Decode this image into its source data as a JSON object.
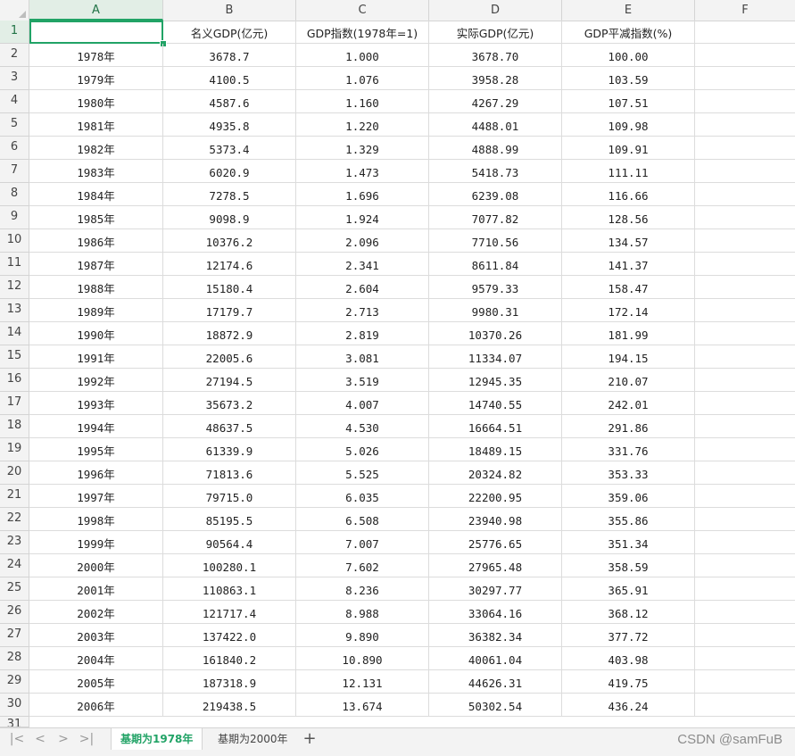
{
  "columns": [
    "A",
    "B",
    "C",
    "D",
    "E",
    "F"
  ],
  "header_row": {
    "row_num": "1",
    "cells": [
      "",
      "名义GDP(亿元)",
      "GDP指数(1978年=1)",
      "实际GDP(亿元)",
      "GDP平减指数(%)",
      ""
    ]
  },
  "rows": [
    {
      "num": "2",
      "year": "1978年",
      "nominal": "3678.7",
      "index": "1.000",
      "real": "3678.70",
      "deflator": "100.00"
    },
    {
      "num": "3",
      "year": "1979年",
      "nominal": "4100.5",
      "index": "1.076",
      "real": "3958.28",
      "deflator": "103.59"
    },
    {
      "num": "4",
      "year": "1980年",
      "nominal": "4587.6",
      "index": "1.160",
      "real": "4267.29",
      "deflator": "107.51"
    },
    {
      "num": "5",
      "year": "1981年",
      "nominal": "4935.8",
      "index": "1.220",
      "real": "4488.01",
      "deflator": "109.98"
    },
    {
      "num": "6",
      "year": "1982年",
      "nominal": "5373.4",
      "index": "1.329",
      "real": "4888.99",
      "deflator": "109.91"
    },
    {
      "num": "7",
      "year": "1983年",
      "nominal": "6020.9",
      "index": "1.473",
      "real": "5418.73",
      "deflator": "111.11"
    },
    {
      "num": "8",
      "year": "1984年",
      "nominal": "7278.5",
      "index": "1.696",
      "real": "6239.08",
      "deflator": "116.66"
    },
    {
      "num": "9",
      "year": "1985年",
      "nominal": "9098.9",
      "index": "1.924",
      "real": "7077.82",
      "deflator": "128.56"
    },
    {
      "num": "10",
      "year": "1986年",
      "nominal": "10376.2",
      "index": "2.096",
      "real": "7710.56",
      "deflator": "134.57"
    },
    {
      "num": "11",
      "year": "1987年",
      "nominal": "12174.6",
      "index": "2.341",
      "real": "8611.84",
      "deflator": "141.37"
    },
    {
      "num": "12",
      "year": "1988年",
      "nominal": "15180.4",
      "index": "2.604",
      "real": "9579.33",
      "deflator": "158.47"
    },
    {
      "num": "13",
      "year": "1989年",
      "nominal": "17179.7",
      "index": "2.713",
      "real": "9980.31",
      "deflator": "172.14"
    },
    {
      "num": "14",
      "year": "1990年",
      "nominal": "18872.9",
      "index": "2.819",
      "real": "10370.26",
      "deflator": "181.99"
    },
    {
      "num": "15",
      "year": "1991年",
      "nominal": "22005.6",
      "index": "3.081",
      "real": "11334.07",
      "deflator": "194.15"
    },
    {
      "num": "16",
      "year": "1992年",
      "nominal": "27194.5",
      "index": "3.519",
      "real": "12945.35",
      "deflator": "210.07"
    },
    {
      "num": "17",
      "year": "1993年",
      "nominal": "35673.2",
      "index": "4.007",
      "real": "14740.55",
      "deflator": "242.01"
    },
    {
      "num": "18",
      "year": "1994年",
      "nominal": "48637.5",
      "index": "4.530",
      "real": "16664.51",
      "deflator": "291.86"
    },
    {
      "num": "19",
      "year": "1995年",
      "nominal": "61339.9",
      "index": "5.026",
      "real": "18489.15",
      "deflator": "331.76"
    },
    {
      "num": "20",
      "year": "1996年",
      "nominal": "71813.6",
      "index": "5.525",
      "real": "20324.82",
      "deflator": "353.33"
    },
    {
      "num": "21",
      "year": "1997年",
      "nominal": "79715.0",
      "index": "6.035",
      "real": "22200.95",
      "deflator": "359.06"
    },
    {
      "num": "22",
      "year": "1998年",
      "nominal": "85195.5",
      "index": "6.508",
      "real": "23940.98",
      "deflator": "355.86"
    },
    {
      "num": "23",
      "year": "1999年",
      "nominal": "90564.4",
      "index": "7.007",
      "real": "25776.65",
      "deflator": "351.34"
    },
    {
      "num": "24",
      "year": "2000年",
      "nominal": "100280.1",
      "index": "7.602",
      "real": "27965.48",
      "deflator": "358.59"
    },
    {
      "num": "25",
      "year": "2001年",
      "nominal": "110863.1",
      "index": "8.236",
      "real": "30297.77",
      "deflator": "365.91"
    },
    {
      "num": "26",
      "year": "2002年",
      "nominal": "121717.4",
      "index": "8.988",
      "real": "33064.16",
      "deflator": "368.12"
    },
    {
      "num": "27",
      "year": "2003年",
      "nominal": "137422.0",
      "index": "9.890",
      "real": "36382.34",
      "deflator": "377.72"
    },
    {
      "num": "28",
      "year": "2004年",
      "nominal": "161840.2",
      "index": "10.890",
      "real": "40061.04",
      "deflator": "403.98"
    },
    {
      "num": "29",
      "year": "2005年",
      "nominal": "187318.9",
      "index": "12.131",
      "real": "44626.31",
      "deflator": "419.75"
    },
    {
      "num": "30",
      "year": "2006年",
      "nominal": "219438.5",
      "index": "13.674",
      "real": "50302.54",
      "deflator": "436.24"
    }
  ],
  "partial_row_num": "31",
  "sheet_tabs": [
    {
      "label": "基期为1978年",
      "active": true
    },
    {
      "label": "基期为2000年",
      "active": false
    }
  ],
  "nav_icons": [
    "first-sheet-icon",
    "prev-sheet-icon",
    "next-sheet-icon",
    "last-sheet-icon"
  ],
  "add_sheet_icon": "plus-icon",
  "watermark": "CSDN @samFuB",
  "colors": {
    "accent": "#21a366",
    "header_bg": "#f3f3f3",
    "grid": "#dcdcdc"
  }
}
